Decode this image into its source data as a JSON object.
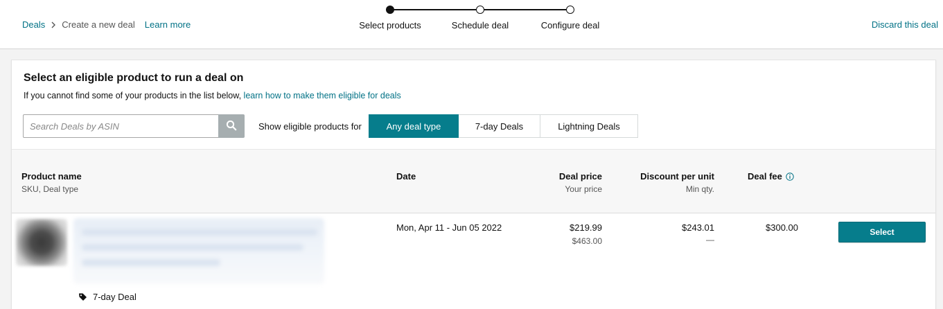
{
  "breadcrumb": {
    "root": "Deals",
    "current": "Create a new deal",
    "learn_more": "Learn more"
  },
  "stepper": {
    "steps": [
      "Select products",
      "Schedule deal",
      "Configure deal"
    ],
    "active_index": 0
  },
  "header": {
    "discard": "Discard this deal"
  },
  "card": {
    "title": "Select an eligible product to run a deal on",
    "subtitle_prefix": "If you cannot find some of your products in the list below, ",
    "subtitle_link": "learn how to make them eligible for deals"
  },
  "search": {
    "placeholder": "Search Deals by ASIN",
    "value": "",
    "icon": "search-icon"
  },
  "filter": {
    "label": "Show eligible products for",
    "options": [
      "Any deal type",
      "7-day Deals",
      "Lightning Deals"
    ],
    "selected": "Any deal type"
  },
  "table": {
    "columns": {
      "product": {
        "label": "Product name",
        "sub": "SKU, Deal type"
      },
      "date": {
        "label": "Date"
      },
      "deal_price": {
        "label": "Deal price",
        "sub": "Your price"
      },
      "discount": {
        "label": "Discount per unit",
        "sub": "Min qty."
      },
      "deal_fee": {
        "label": "Deal fee",
        "icon": "info-icon"
      }
    },
    "rows": [
      {
        "deal_type": "7-day Deal",
        "date": "Mon, Apr 11 - Jun 05 2022",
        "deal_price": "$219.99",
        "your_price": "$463.00",
        "discount": "$243.01",
        "min_qty": "—",
        "deal_fee": "$300.00",
        "action": "Select"
      }
    ]
  },
  "colors": {
    "accent": "#067d8c",
    "link": "#007185"
  }
}
